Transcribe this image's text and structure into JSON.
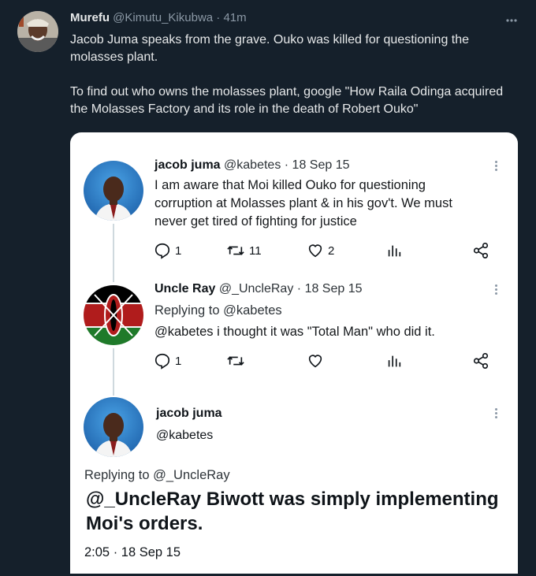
{
  "outer_tweet": {
    "author_name": "Murefu",
    "author_handle": "@Kimutu_Kikubwa",
    "time": "41m",
    "paragraphs": [
      "Jacob Juma speaks from the grave. Ouko was killed for questioning the molasses plant.",
      "To find out who owns the molasses plant, google \"How Raila Odinga acquired the Molasses Factory and its role in the death of Robert Ouko\""
    ]
  },
  "embedded_thread": {
    "tweets": [
      {
        "name": "jacob juma",
        "handle": "@kabetes",
        "date": "18 Sep 15",
        "text": "I am aware that Moi killed Ouko for questioning corruption at Molasses plant & in his gov't. We must never get tired of fighting for justice",
        "replies": "1",
        "retweets": "11",
        "likes": "2"
      },
      {
        "name": "Uncle Ray",
        "handle": "@_UncleRay",
        "date": "18 Sep 15",
        "replying_to": "Replying to @kabetes",
        "text": "@kabetes i thought it was \"Total Man\" who did it.",
        "replies": "1",
        "retweets": "",
        "likes": ""
      }
    ],
    "focused": {
      "name": "jacob juma",
      "handle": "@kabetes",
      "replying_to": "Replying to @_UncleRay",
      "text": "@_UncleRay Biwott was simply implementing Moi's orders.",
      "timestamp": "2:05 · 18 Sep 15"
    }
  },
  "colors": {
    "background": "#15202b",
    "card": "#ffffff",
    "muted": "#8b98a5"
  }
}
